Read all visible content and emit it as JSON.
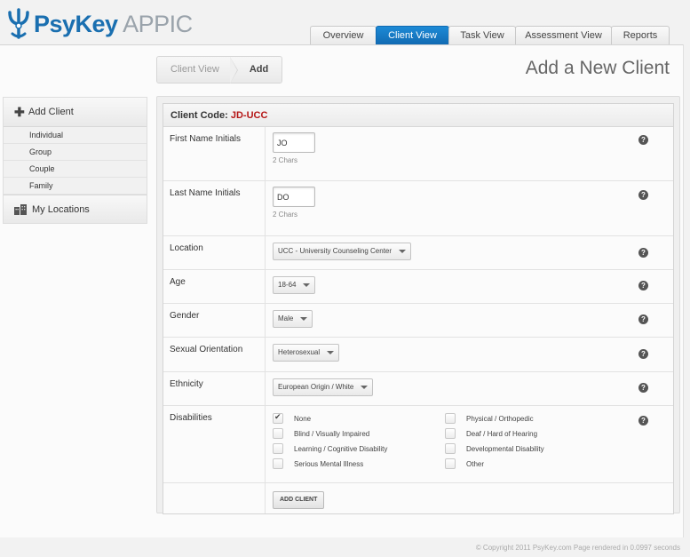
{
  "app": {
    "name_primary": "PsyKey",
    "name_secondary": "APPIC"
  },
  "tabs": [
    {
      "label": "Overview",
      "active": false
    },
    {
      "label": "Client View",
      "active": true
    },
    {
      "label": "Task View",
      "active": false
    },
    {
      "label": "Assessment View",
      "active": false
    },
    {
      "label": "Reports",
      "active": false
    }
  ],
  "breadcrumb": [
    "Client View",
    "Add"
  ],
  "page_title": "Add a New Client",
  "sidebar": {
    "add_client": "Add Client",
    "items": [
      "Individual",
      "Group",
      "Couple",
      "Family"
    ],
    "locations": "My Locations"
  },
  "form": {
    "code_label": "Client Code:",
    "code_value": "JD-UCC",
    "first_name": {
      "label": "First Name Initials",
      "value": "JO",
      "hint": "2 Chars"
    },
    "last_name": {
      "label": "Last Name Initials",
      "value": "DO",
      "hint": "2 Chars"
    },
    "location": {
      "label": "Location",
      "value": "UCC - University Counseling Center"
    },
    "age": {
      "label": "Age",
      "value": "18-64"
    },
    "gender": {
      "label": "Gender",
      "value": "Male"
    },
    "orientation": {
      "label": "Sexual Orientation",
      "value": "Heterosexual"
    },
    "ethnicity": {
      "label": "Ethnicity",
      "value": "European Origin / White"
    },
    "disabilities": {
      "label": "Disabilities",
      "options": [
        {
          "label": "None",
          "checked": true
        },
        {
          "label": "Physical / Orthopedic",
          "checked": false
        },
        {
          "label": "Blind / Visually Impaired",
          "checked": false
        },
        {
          "label": "Deaf / Hard of Hearing",
          "checked": false
        },
        {
          "label": "Learning / Cognitive Disability",
          "checked": false
        },
        {
          "label": "Developmental Disability",
          "checked": false
        },
        {
          "label": "Serious Mental Illness",
          "checked": false
        },
        {
          "label": "Other",
          "checked": false
        }
      ]
    },
    "submit": "ADD CLIENT",
    "help": "?"
  },
  "footer": "© Copyright 2011 PsyKey.com Page rendered in 0.0997 seconds",
  "colors": {
    "accent": "#1a6fb0",
    "code": "#b51616"
  }
}
